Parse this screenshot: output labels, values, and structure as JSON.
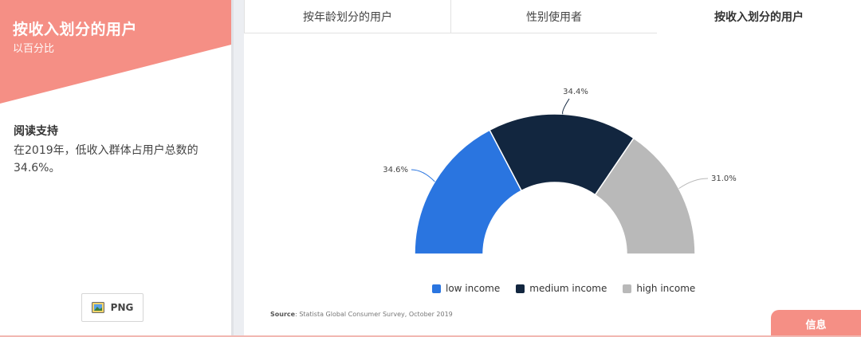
{
  "left_panel": {
    "title": "按收入划分的用户",
    "subtitle": "以百分比",
    "reading_heading": "阅读支持",
    "reading_text": "在2019年，低收入群体占用户总数的34.6%。",
    "png_button_label": "PNG",
    "banner_color": "#f58f85"
  },
  "tabs": [
    {
      "label": "按年龄划分的用户",
      "active": false
    },
    {
      "label": "性别使用者",
      "active": false
    },
    {
      "label": "按收入划分的用户",
      "active": true
    }
  ],
  "chart_data": {
    "type": "pie",
    "shape": "half-donut",
    "categories": [
      "low income",
      "medium income",
      "high income"
    ],
    "values": [
      34.6,
      34.4,
      31.0
    ],
    "labels": [
      "34.6%",
      "34.4%",
      "31.0%"
    ],
    "colors": [
      "#2a75e0",
      "#12263f",
      "#b9b9b9"
    ],
    "legend_position": "bottom"
  },
  "source": {
    "prefix": "Source",
    "text": ": Statista Global Consumer Survey, October 2019"
  },
  "info_button_label": "信息"
}
